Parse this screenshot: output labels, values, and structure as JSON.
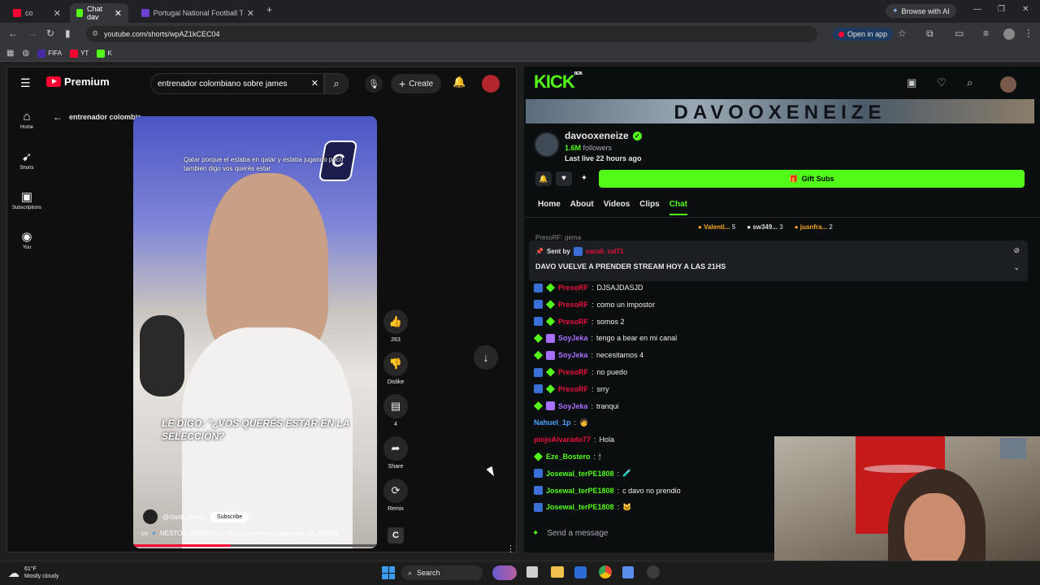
{
  "browser": {
    "tabs": [
      {
        "label": "co",
        "active": false
      },
      {
        "label": "Chat dav",
        "active": true
      },
      {
        "label": "Portugal National Football Team",
        "active": false
      }
    ],
    "new_tab_icon": "+",
    "browse_ai": "Browse with AI",
    "url": "youtube.com/shorts/wpAZ1kCEC04",
    "open_in_app": "Open in app",
    "bookmarks": [
      "FIFA",
      "YT",
      "K"
    ]
  },
  "youtube": {
    "logo_text": "Premium",
    "search_value": "entrenador colombiano sobre james",
    "create_label": "Create",
    "nav": [
      {
        "label": "Home",
        "icon": "home-icon"
      },
      {
        "label": "Shorts",
        "icon": "shorts-icon"
      },
      {
        "label": "Subscriptions",
        "icon": "subscriptions-icon"
      },
      {
        "label": "You",
        "icon": "you-icon"
      }
    ],
    "back_title": "entrenador colombia...",
    "caption_top": "Qatar porque el estaba en qatar y estaba jugando poco también digo vos querés estar",
    "caption_main": "LE DIGO: \"¿VOS QUERÉS ESTAR EN LA SELECCIÓN?",
    "channel": "@clank_media",
    "subscribe": "Subscribe",
    "video_title": "co 🔹 NÉSTOR LORENZO y el proceso de recuperación de JAMES ...",
    "actions": {
      "likes": "263",
      "dislike": "Dislike",
      "comments": "4",
      "share": "Share",
      "remix": "Remix"
    }
  },
  "kick": {
    "logo": "KICK",
    "logo_badge": "BETA",
    "banner_text": "DAVOOXENEIZE",
    "channel_name": "davooxeneize",
    "followers_count": "1.6M",
    "followers_label": "followers",
    "last_live": "Last live 22 hours ago",
    "gift_subs": "Gift Subs",
    "tabs": [
      "Home",
      "About",
      "Videos",
      "Clips",
      "Chat"
    ],
    "active_tab": "Chat",
    "top_gifters": [
      {
        "name": "Valenti...",
        "count": "5"
      },
      {
        "name": "sw349...",
        "count": "3"
      },
      {
        "name": "juanfra...",
        "count": "2"
      }
    ],
    "pinned_label": "Sent by",
    "pinned_sender": "sacali_cal71",
    "pinned_message": "DAVO VUELVE A PRENDER STREAM HOY A LAS 21HS",
    "partial_line": "PresoRF: gema",
    "messages": [
      {
        "user": "PresoRF",
        "text": "DJSAJDASJD",
        "color": "#e9113c",
        "badges": [
          "blue",
          "green"
        ]
      },
      {
        "user": "PresoRF",
        "text": "como un impostor",
        "color": "#e9113c",
        "badges": [
          "blue",
          "green"
        ]
      },
      {
        "user": "PresoRF",
        "text": "somos 2",
        "color": "#e9113c",
        "badges": [
          "blue",
          "green"
        ]
      },
      {
        "user": "SoyJeka",
        "text": "tengo a bear en mi canal",
        "color": "#a970ff",
        "badges": [
          "green",
          "purple"
        ]
      },
      {
        "user": "SoyJeka",
        "text": "necesitamos 4",
        "color": "#a970ff",
        "badges": [
          "green",
          "purple"
        ]
      },
      {
        "user": "PresoRF",
        "text": "no puedo",
        "color": "#e9113c",
        "badges": [
          "blue",
          "green"
        ]
      },
      {
        "user": "PresoRF",
        "text": "srry",
        "color": "#e9113c",
        "badges": [
          "blue",
          "green"
        ]
      },
      {
        "user": "SoyJeka",
        "text": "tranqui",
        "color": "#a970ff",
        "badges": [
          "green",
          "purple"
        ]
      },
      {
        "user": "Nahuel_1p",
        "text": "🧑",
        "color": "#4ea1ff",
        "badges": []
      },
      {
        "user": "piojoAlvarado77",
        "text": "Hola",
        "color": "#e9113c",
        "badges": []
      },
      {
        "user": "Eze_Bostero",
        "text": "🕯",
        "color": "#53fc18",
        "badges": [
          "green"
        ]
      },
      {
        "user": "Josewal_terPE1808",
        "text": "🧪",
        "color": "#53fc18",
        "badges": [
          "blue"
        ]
      },
      {
        "user": "Josewal_terPE1808",
        "text": "c davo no prendio",
        "color": "#53fc18",
        "badges": [
          "blue"
        ]
      },
      {
        "user": "Josewal_terPE1808",
        "text": "🐱",
        "color": "#53fc18",
        "badges": [
          "blue"
        ]
      }
    ],
    "send_placeholder": "Send a message"
  },
  "taskbar": {
    "weather_temp": "61°F",
    "weather_desc": "Mostly cloudy",
    "search_label": "Search"
  }
}
